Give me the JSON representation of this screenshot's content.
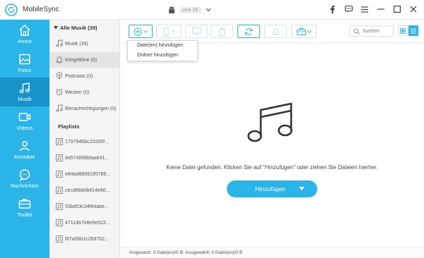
{
  "app": {
    "title": "MobileSync",
    "device_name": "vivo Z6"
  },
  "sidebar": {
    "items": [
      {
        "label": "Home",
        "icon": "home-icon"
      },
      {
        "label": "Fotos",
        "icon": "photo-icon"
      },
      {
        "label": "Musik",
        "icon": "music-icon",
        "active": true
      },
      {
        "label": "Videos",
        "icon": "video-icon"
      },
      {
        "label": "Kontakte",
        "icon": "contacts-icon"
      },
      {
        "label": "Nachrichten",
        "icon": "message-icon"
      },
      {
        "label": "Toolkit",
        "icon": "toolkit-icon"
      }
    ]
  },
  "categories": {
    "header": "Alle Musik (39)",
    "items": [
      {
        "label": "Musik (39)",
        "icon": "music-note-icon"
      },
      {
        "label": "Klingeltöne (0)",
        "icon": "bell-icon",
        "active": true
      },
      {
        "label": "Podcasts (0)",
        "icon": "podcast-icon"
      },
      {
        "label": "Wecker (0)",
        "icon": "alarm-icon"
      },
      {
        "label": "Benachrichtigungen (0)",
        "icon": "notification-icon"
      }
    ],
    "playlist_header": "Playlists",
    "playlists": [
      "1797940bc22d35f...",
      "8d574096bfaa641...",
      "e84ad8669195789...",
      "cecd68d4b914e80...",
      "53bd53c34f64abe...",
      "47114b7e8e9e522...",
      "6f7a06b1c26d762..."
    ]
  },
  "toolbar": {
    "search_placeholder": "Suchen",
    "add_menu": [
      "Datei(en) hinzufügen",
      "Ordner hinzufügen"
    ]
  },
  "main": {
    "empty_message": "Keine Datei gefunden. Klicken Sie auf \"Hinzufügen\" oder ziehen Sie Dateien hierher.",
    "add_button": "Hinzufügen"
  },
  "status": {
    "text": "Insgesamt: 0 Date(en)/0 B; Ausgewählt: 0 Datei(en)/0 B"
  },
  "colors": {
    "accent": "#2ab4e8",
    "accent_dark": "#1793c9"
  }
}
